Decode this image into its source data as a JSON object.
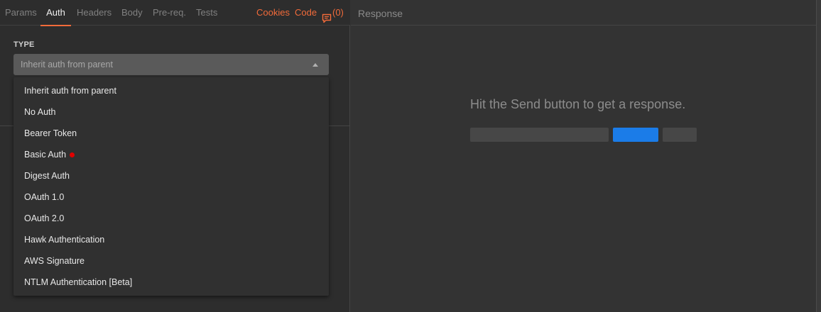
{
  "request_tabs": {
    "params": "Params",
    "auth": "Auth",
    "headers": "Headers",
    "body": "Body",
    "prereq": "Pre-req.",
    "tests": "Tests"
  },
  "top_links": {
    "cookies": "Cookies",
    "code": "Code",
    "comments_count": "(0)"
  },
  "auth": {
    "type_label": "TYPE",
    "selected_type": "Inherit auth from parent",
    "options": [
      "Inherit auth from parent",
      "No Auth",
      "Bearer Token",
      "Basic Auth",
      "Digest Auth",
      "OAuth 1.0",
      "OAuth 2.0",
      "Hawk Authentication",
      "AWS Signature",
      "NTLM Authentication [Beta]"
    ]
  },
  "response": {
    "title": "Response",
    "empty_message": "Hit the Send button to get a response."
  },
  "colors": {
    "accent": "#f26b3a",
    "send_blue": "#1b7ce8",
    "marker_red": "#e00000"
  },
  "icons": {
    "comments": "comment-icon",
    "dropdown_caret": "caret-up-icon",
    "marker": "red-dot-icon"
  }
}
